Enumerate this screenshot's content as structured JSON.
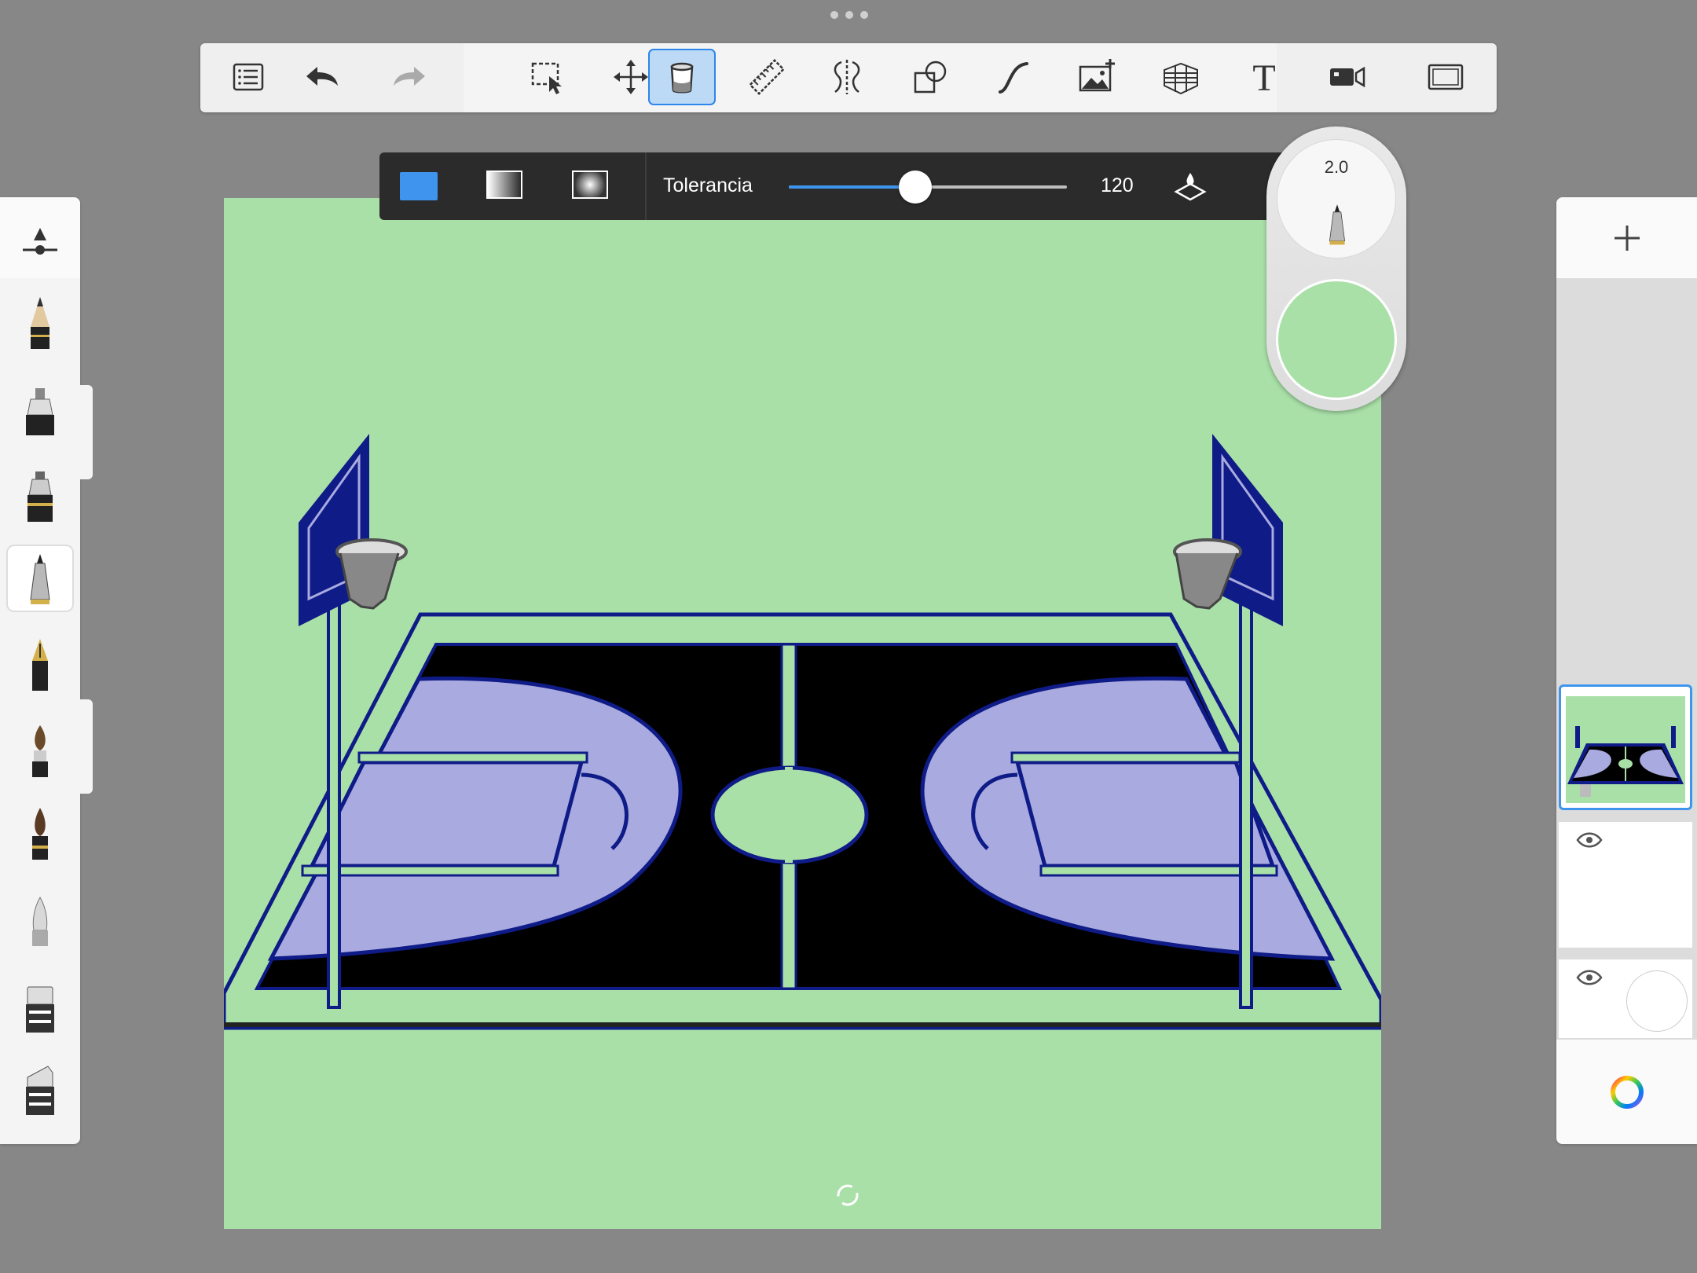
{
  "top_toolbar": {
    "tools": [
      {
        "name": "list-icon",
        "label": "Gallery"
      },
      {
        "name": "undo-icon",
        "label": "Undo"
      },
      {
        "name": "redo-icon",
        "label": "Redo"
      },
      {
        "name": "selection-icon",
        "label": "Selection"
      },
      {
        "name": "move-icon",
        "label": "Transform"
      },
      {
        "name": "fill-bucket-icon",
        "label": "Fill",
        "active": true
      },
      {
        "name": "ruler-icon",
        "label": "Ruler"
      },
      {
        "name": "symmetry-icon",
        "label": "Symmetry"
      },
      {
        "name": "shapes-icon",
        "label": "Shapes"
      },
      {
        "name": "curve-icon",
        "label": "Stroke"
      },
      {
        "name": "image-icon",
        "label": "Image"
      },
      {
        "name": "perspective-icon",
        "label": "Perspective"
      },
      {
        "name": "text-icon",
        "label": "Text"
      },
      {
        "name": "video-icon",
        "label": "Record"
      },
      {
        "name": "fullscreen-icon",
        "label": "Fullscreen"
      }
    ]
  },
  "fill_bar": {
    "modes": [
      "solid",
      "linear-gradient",
      "radial-gradient"
    ],
    "selected_mode": "solid",
    "tolerance_label": "Tolerancia",
    "tolerance_value": "120",
    "tolerance_fraction": 0.455,
    "accent_color": "#3f95ee"
  },
  "brush_puck": {
    "size": "2.0",
    "color": "#a9e0a8"
  },
  "brushes": {
    "selected_index": 4,
    "items": [
      "brush-settings-icon",
      "pencil-icon",
      "marker-icon",
      "airbrush-icon",
      "ballpoint-icon",
      "fountain-pen-icon",
      "paintbrush-icon",
      "ink-brush-icon",
      "smudge-icon",
      "eraser-icon",
      "hard-eraser-icon"
    ]
  },
  "layers": {
    "items": [
      {
        "name": "layer-court",
        "visible": true,
        "selected": true
      },
      {
        "name": "layer-empty",
        "visible": true,
        "selected": false
      },
      {
        "name": "layer-background",
        "visible": true,
        "selected": false
      }
    ]
  },
  "canvas": {
    "background_color": "#a9e0a8",
    "court_color": "#000000",
    "key_color": "#a8aae0",
    "outline_color": "#0f1b86"
  }
}
